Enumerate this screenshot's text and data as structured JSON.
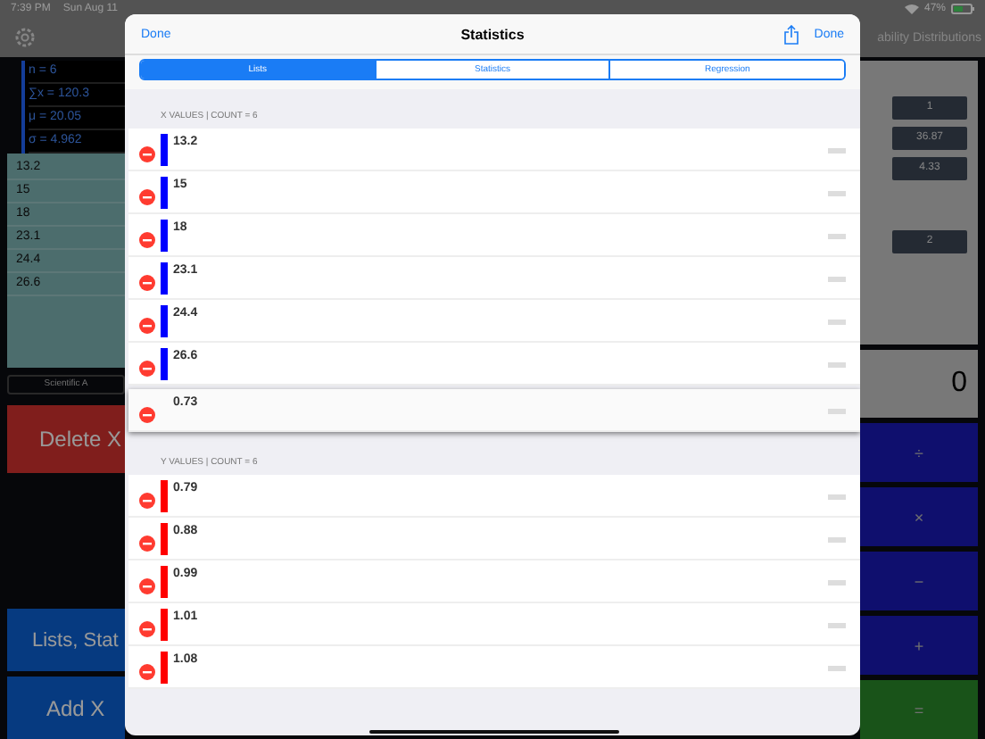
{
  "status_bar": {
    "time": "7:39 PM",
    "date": "Sun Aug 11",
    "battery": "47%"
  },
  "background": {
    "nav_title": "ability Distributions",
    "summary": [
      "n = 6",
      "∑x = 120.3",
      "μ = 20.05",
      "σ = 4.962"
    ],
    "values": [
      "13.2",
      "15",
      "18",
      "23.1",
      "24.4",
      "26.6"
    ],
    "mode": "Scientific A",
    "left_buttons": [
      {
        "label": "Delete X",
        "kind": "delete"
      },
      {
        "label": "Lists, Stat",
        "kind": "lists"
      },
      {
        "label": "Add X",
        "kind": "add"
      }
    ],
    "right_values": [
      "1",
      "36.87",
      "4.33",
      "2"
    ],
    "display": "0",
    "keys": [
      {
        "label": "÷",
        "kind": "operator"
      },
      {
        "label": "×",
        "kind": "operator"
      },
      {
        "label": "−",
        "kind": "operator"
      },
      {
        "label": "+",
        "kind": "operator"
      },
      {
        "label": "=",
        "kind": "equals"
      }
    ]
  },
  "sheet": {
    "left_action": "Done",
    "title": "Statistics",
    "right_action": "Done",
    "segments": [
      {
        "label": "Lists",
        "selected": true
      },
      {
        "label": "Statistics",
        "selected": false
      },
      {
        "label": "Regression",
        "selected": false
      }
    ],
    "sections": [
      {
        "header": "X VALUES | COUNT = 6",
        "color": "#0000ff",
        "rows": [
          "13.2",
          "15",
          "18",
          "23.1",
          "24.4",
          "26.6"
        ]
      },
      {
        "dragged_row": "0.73",
        "header": "Y VALUES | COUNT = 6",
        "color": "#ff0000",
        "rows": [
          "0.79",
          "0.88",
          "0.99",
          "1.01",
          "1.08"
        ]
      }
    ]
  }
}
